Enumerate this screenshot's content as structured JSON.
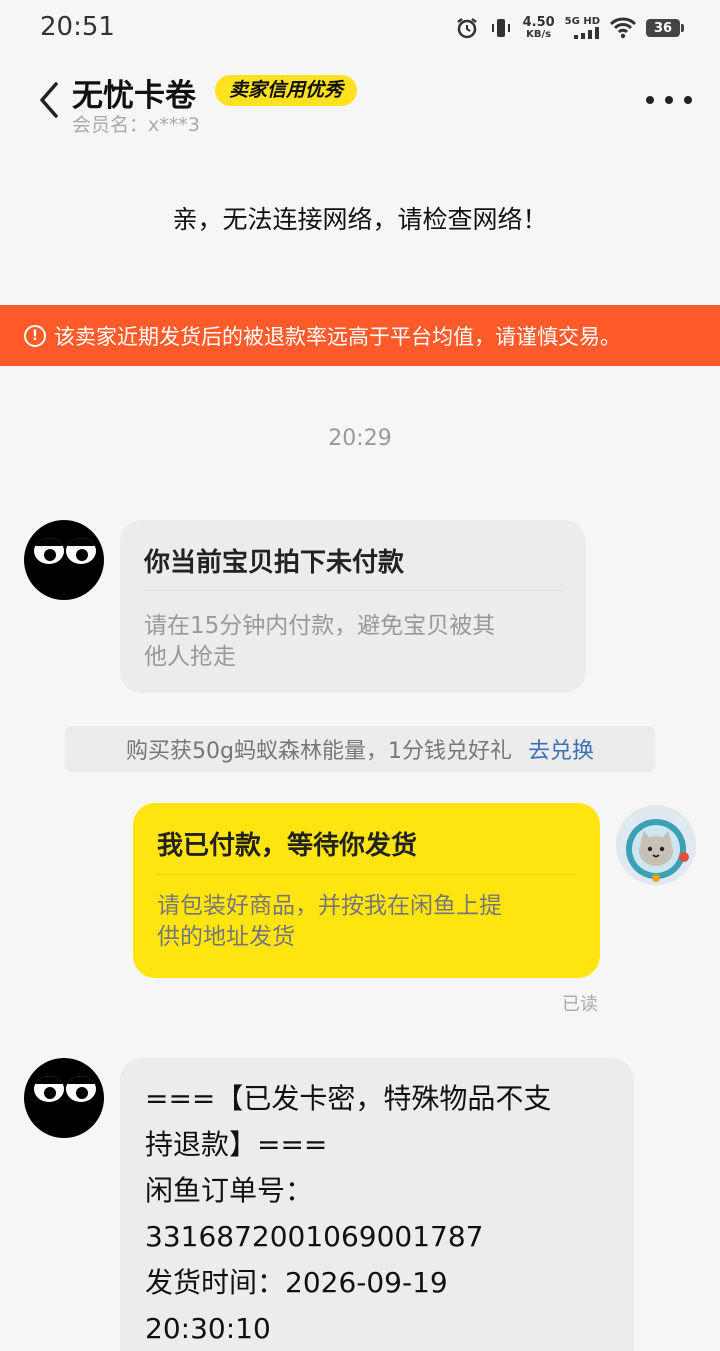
{
  "status_bar": {
    "time": "20:51",
    "net_speed_value": "4.50",
    "net_speed_unit": "KB/s",
    "network_type": "5G HD",
    "battery_level": "36"
  },
  "header": {
    "title": "无忧卡卷",
    "seller_badge": "卖家信用优秀",
    "member_name": "会员名：x***3"
  },
  "network_error": "亲，无法连接网络，请检查网络！",
  "warning_banner": {
    "icon": "!",
    "text": "该卖家近期发货后的被退款率远高于平台均值，请谨慎交易。"
  },
  "chat": {
    "timestamp": "20:29",
    "system_card": {
      "title": "你当前宝贝拍下未付款",
      "subtitle_line1": "请在15分钟内付款，避免宝贝被其",
      "subtitle_line2": "他人抢走"
    },
    "promo": {
      "text": "购买获50g蚂蚁森林能量，1分钱兑好礼",
      "link": "去兑换"
    },
    "buyer_card": {
      "title": "我已付款，等待你发货",
      "subtitle_line1": "请包装好商品，并按我在闲鱼上提",
      "subtitle_line2": "供的地址发货",
      "status": "已读"
    },
    "seller_message": {
      "lines": [
        "===【已发卡密，特殊物品不支",
        "持退款】===",
        "闲鱼订单号：",
        "3316872001069001787",
        "发货时间：2026-09-19",
        "20:30:10"
      ]
    }
  },
  "colors": {
    "accent_yellow": "#ffe50f",
    "warning_orange": "#ff5a2a",
    "link_blue": "#3b6fb6"
  }
}
